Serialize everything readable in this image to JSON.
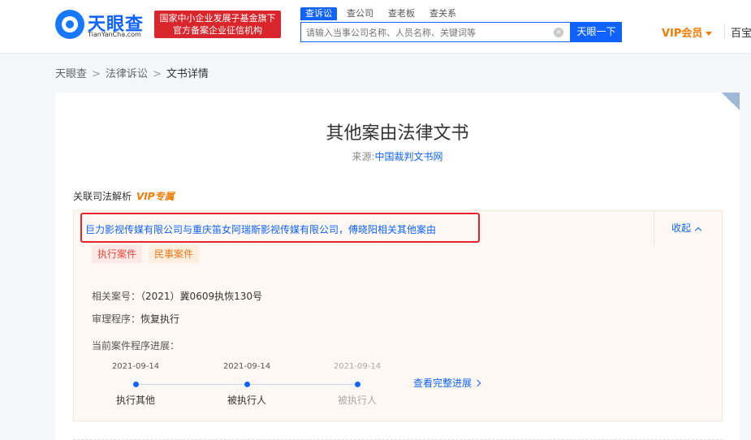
{
  "header": {
    "logo_text": "天眼查",
    "logo_sub": "TianYanCha.com",
    "badge_line1": "国家中小企业发展子基金旗下",
    "badge_line2": "官方备案企业征信机构",
    "search_tabs": [
      {
        "label": "查诉讼",
        "active": true
      },
      {
        "label": "查公司",
        "active": false
      },
      {
        "label": "查老板",
        "active": false
      },
      {
        "label": "查关系",
        "active": false
      }
    ],
    "search_placeholder": "请输入当事公司名称、人员名称、关键词等",
    "search_button": "天眼一下",
    "vip_label": "VIP会员",
    "right_text": "百宝"
  },
  "breadcrumb": [
    "天眼查",
    "法律诉讼",
    "文书详情"
  ],
  "document": {
    "title": "其他案由法律文书",
    "source_label": "来源:",
    "source_value": "中国裁判文书网"
  },
  "section": {
    "label": "关联司法解析",
    "vip_tag": "VIP专属"
  },
  "case": {
    "title": "巨力影视传媒有限公司与重庆笛女阿瑞斯影视传媒有限公司，傅晓阳相关其他案由",
    "collapse_label": "收起",
    "tags": [
      "执行案件",
      "民事案件"
    ],
    "case_no_label": "相关案号：",
    "case_no_value": "（2021）冀0609执恢130号",
    "procedure_label": "审理程序：",
    "procedure_value": "恢复执行",
    "progress_label": "当前案件程序进展：",
    "timeline": [
      {
        "date": "2021-09-14",
        "label": "执行其他",
        "faded": false
      },
      {
        "date": "2021-09-14",
        "label": "被执行人",
        "faded": false
      },
      {
        "date": "2021-09-14",
        "label": "被执行人",
        "faded": true
      }
    ],
    "view_full_label": "查看完整进展"
  }
}
